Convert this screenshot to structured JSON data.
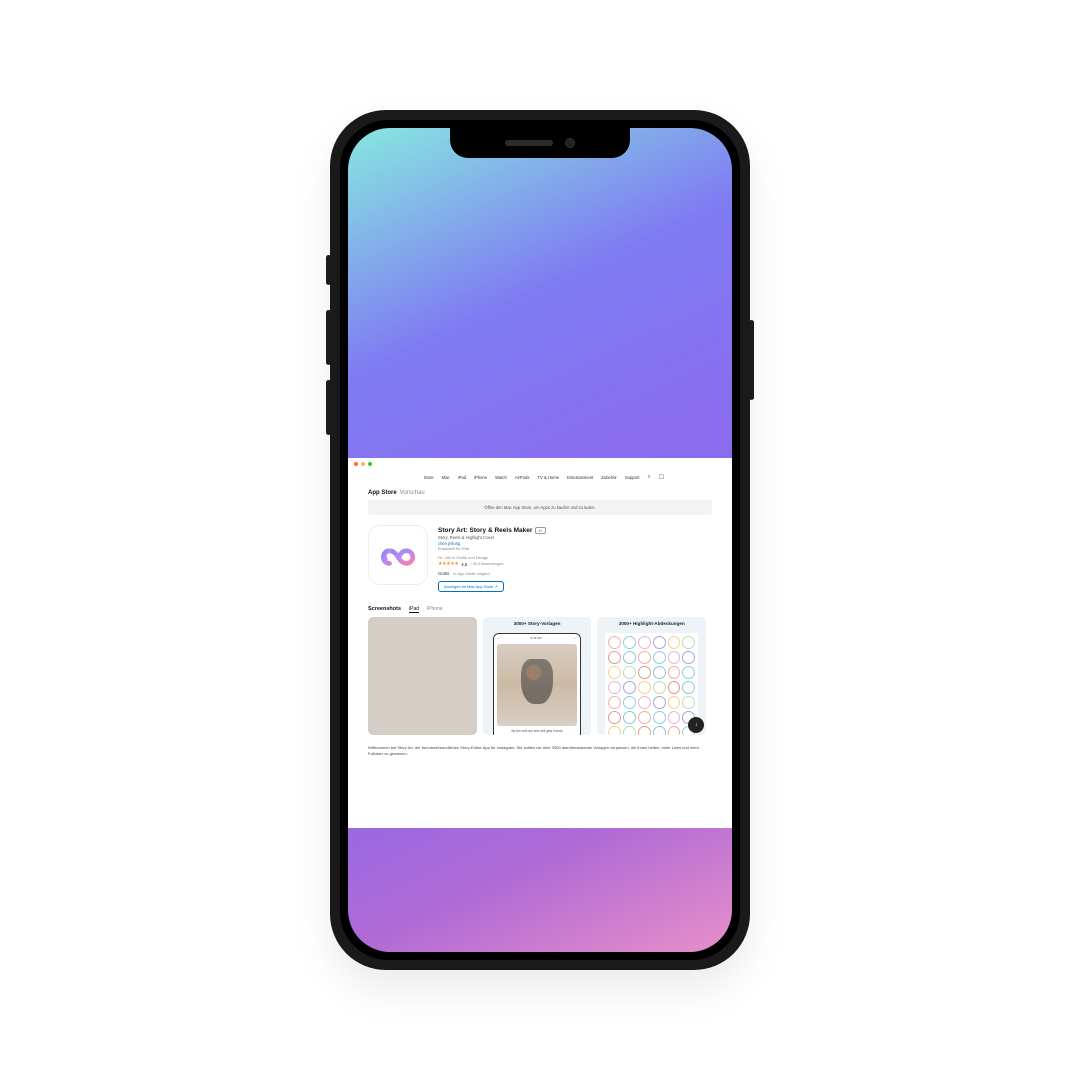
{
  "nav": {
    "items": [
      "Store",
      "Mac",
      "iPad",
      "iPhone",
      "Watch",
      "AirPods",
      "TV & Home",
      "Entertainment",
      "Zubehör",
      "Support"
    ]
  },
  "page": {
    "title": "App Store",
    "title_suffix": "Vorschau",
    "banner": "Öffne den Mac App Store, um Apps zu kaufen und zu laden."
  },
  "app": {
    "name": "Story Art: Story & Reels Maker",
    "age": "4+",
    "subtitle": "Story, Reels & Highlight Cover",
    "developer": "chen jinlong",
    "designed_for": "Entwickelt für iPad",
    "rank": "Nr. 184 in Grafik und Design",
    "stars": "★★★★★",
    "rating_value": "4,5",
    "rating_count": "• 45,4 Bewertungen",
    "price": "Gratis",
    "iap_note": "In-App-Käufe möglich",
    "view_button": "Anzeigen im Mac App Store ↗"
  },
  "screenshots": {
    "title": "Screenshots",
    "tabs": {
      "ipad": "iPad",
      "iphone": "iPhone"
    },
    "shot2_title": "3000+ Story-Vorlagen",
    "shot3_title": "3000+ Highlight-Abdeckungen",
    "shot2_caption": "Be the soft one who still gets it done",
    "time": "9:41 AM"
  },
  "description": {
    "line1": "Willkommen bei Story Art, der benutzerfreundlichen Story-Editor-App für Instagram. Sie sollten nie über 3000 atemberaubende Vorlagen verpassen, die Ihnen helfen, mehr Likes und mehr Follower zu gewinnen."
  }
}
